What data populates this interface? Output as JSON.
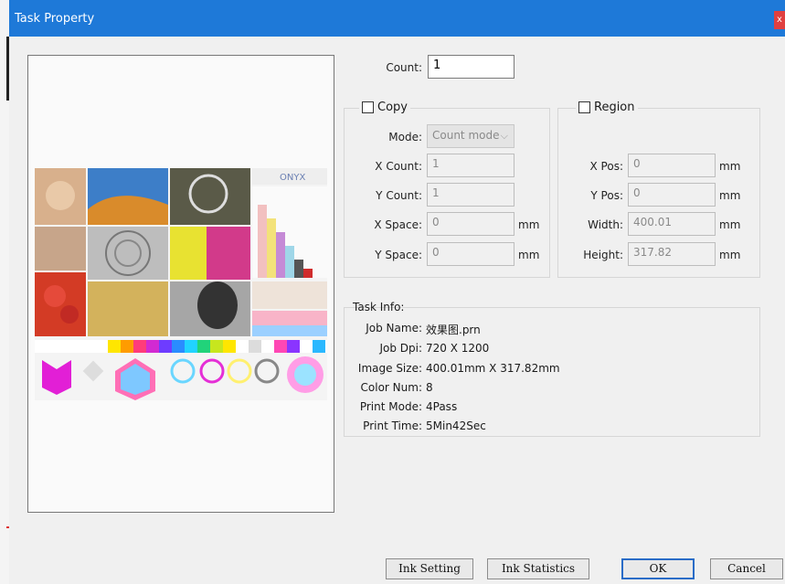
{
  "window": {
    "title": "Task Property",
    "close_glyph": "x"
  },
  "count": {
    "label": "Count:",
    "value": "1"
  },
  "copy": {
    "label": "Copy",
    "checked": false,
    "mode_label": "Mode:",
    "mode_value": "Count mode",
    "x_count_label": "X Count:",
    "x_count_value": "1",
    "y_count_label": "Y Count:",
    "y_count_value": "1",
    "x_space_label": "X Space:",
    "x_space_value": "0",
    "y_space_label": "Y Space:",
    "y_space_value": "0",
    "unit": "mm"
  },
  "region": {
    "label": "Region",
    "checked": false,
    "x_pos_label": "X Pos:",
    "x_pos_value": "0",
    "y_pos_label": "Y Pos:",
    "y_pos_value": "0",
    "width_label": "Width:",
    "width_value": "400.01",
    "height_label": "Height:",
    "height_value": "317.82",
    "unit": "mm"
  },
  "task_info": {
    "title": "Task Info:",
    "rows": [
      {
        "k": "Job Name:",
        "v": "效果图.prn"
      },
      {
        "k": "Job Dpi:",
        "v": "720 X 1200"
      },
      {
        "k": "Image Size:",
        "v": "400.01mm X 317.82mm"
      },
      {
        "k": "Color Num:",
        "v": "8"
      },
      {
        "k": "Print Mode:",
        "v": "4Pass"
      },
      {
        "k": "Print Time:",
        "v": "5Min42Sec"
      }
    ]
  },
  "preview": {
    "brand_text": "ONYX"
  },
  "buttons": {
    "ink_setting": "Ink Setting",
    "ink_statistics": "Ink Statistics",
    "ok": "OK",
    "cancel": "Cancel"
  },
  "colors": {
    "titlebar": "#1e79d8",
    "close": "#e04040",
    "dialog_bg": "#f0f0f0"
  }
}
